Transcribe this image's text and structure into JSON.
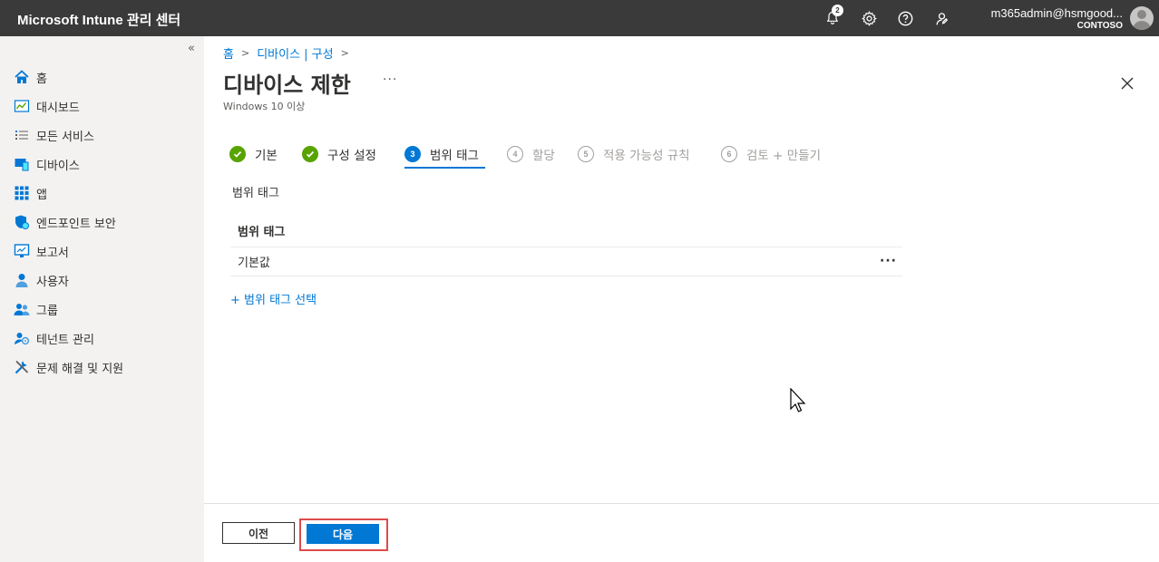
{
  "topbar": {
    "title": "Microsoft Intune 관리 센터",
    "notification_count": "2",
    "user_email": "m365admin@hsmgood...",
    "user_org": "CONTOSO",
    "icons": [
      "bell-icon",
      "gear-icon",
      "help-icon",
      "feedback-icon"
    ]
  },
  "sidebar": {
    "collapse_glyph": "«",
    "items": [
      {
        "label": "홈",
        "icon": "home-icon"
      },
      {
        "label": "대시보드",
        "icon": "dashboard-icon"
      },
      {
        "label": "모든 서비스",
        "icon": "list-icon"
      },
      {
        "label": "디바이스",
        "icon": "devices-icon"
      },
      {
        "label": "앱",
        "icon": "apps-icon"
      },
      {
        "label": "엔드포인트 보안",
        "icon": "shield-icon"
      },
      {
        "label": "보고서",
        "icon": "reports-icon"
      },
      {
        "label": "사용자",
        "icon": "user-icon"
      },
      {
        "label": "그룹",
        "icon": "group-icon"
      },
      {
        "label": "테넌트 관리",
        "icon": "tenant-icon"
      },
      {
        "label": "문제 해결 및 지원",
        "icon": "tools-icon"
      }
    ]
  },
  "breadcrumb": [
    "홈",
    "디바이스 | 구성"
  ],
  "page": {
    "title": "디바이스 제한",
    "subtitle": "Windows 10 이상",
    "more": "···"
  },
  "steps": [
    {
      "num": "",
      "label": "기본",
      "state": "done"
    },
    {
      "num": "",
      "label": "구성 설정",
      "state": "done"
    },
    {
      "num": "3",
      "label": "범위 태그",
      "state": "active"
    },
    {
      "num": "4",
      "label": "할당",
      "state": "todo"
    },
    {
      "num": "5",
      "label": "적용 가능성 규칙",
      "state": "todo"
    },
    {
      "num": "6",
      "label": "검토 + 만들기",
      "state": "todo"
    }
  ],
  "scope": {
    "section_label": "범위 태그",
    "table_header": "범위 태그",
    "rows": [
      {
        "value": "기본값",
        "more": "···"
      }
    ],
    "add_link": "+ 범위 태그 선택"
  },
  "footer": {
    "prev_label": "이전",
    "next_label": "다음"
  },
  "colors": {
    "topbar": "#3a3a3a",
    "accent": "#0078d4",
    "success": "#57a300",
    "highlight": "#e04a4a"
  }
}
